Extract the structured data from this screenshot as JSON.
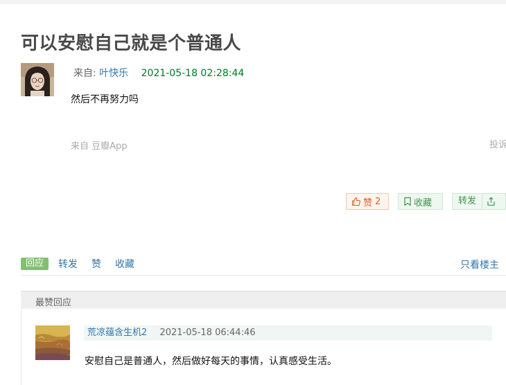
{
  "post": {
    "title": "可以安慰自己就是个普通人",
    "from_label": "来自:",
    "author": "叶快乐",
    "timestamp": "2021-05-18 02:28:44",
    "content": "然后不再努力吗",
    "source": "来自 豆瓣App",
    "report_label": "投诉"
  },
  "actions": {
    "like_label": "赞",
    "like_count": "2",
    "collect_label": "收藏",
    "reshare_label": "转发"
  },
  "tabs": {
    "reply": "回应",
    "reshare": "转发",
    "like": "赞",
    "collect": "收藏",
    "only_op": "只看楼主"
  },
  "hot_replies": {
    "header": "最赞回应",
    "items": [
      {
        "author": "荒凉蕴含生机2",
        "timestamp": "2021-05-18 06:44:46",
        "text": "安慰自己是普通人，然后做好每天的事情，认真感受生活。"
      }
    ]
  },
  "colors": {
    "link": "#3377aa",
    "time_green": "#007722",
    "accent_green": "#83bf73",
    "like_orange": "#e25d2b"
  },
  "icons": {
    "like": "thumbs-up-icon",
    "collect": "bookmark-icon",
    "share": "share-icon"
  }
}
